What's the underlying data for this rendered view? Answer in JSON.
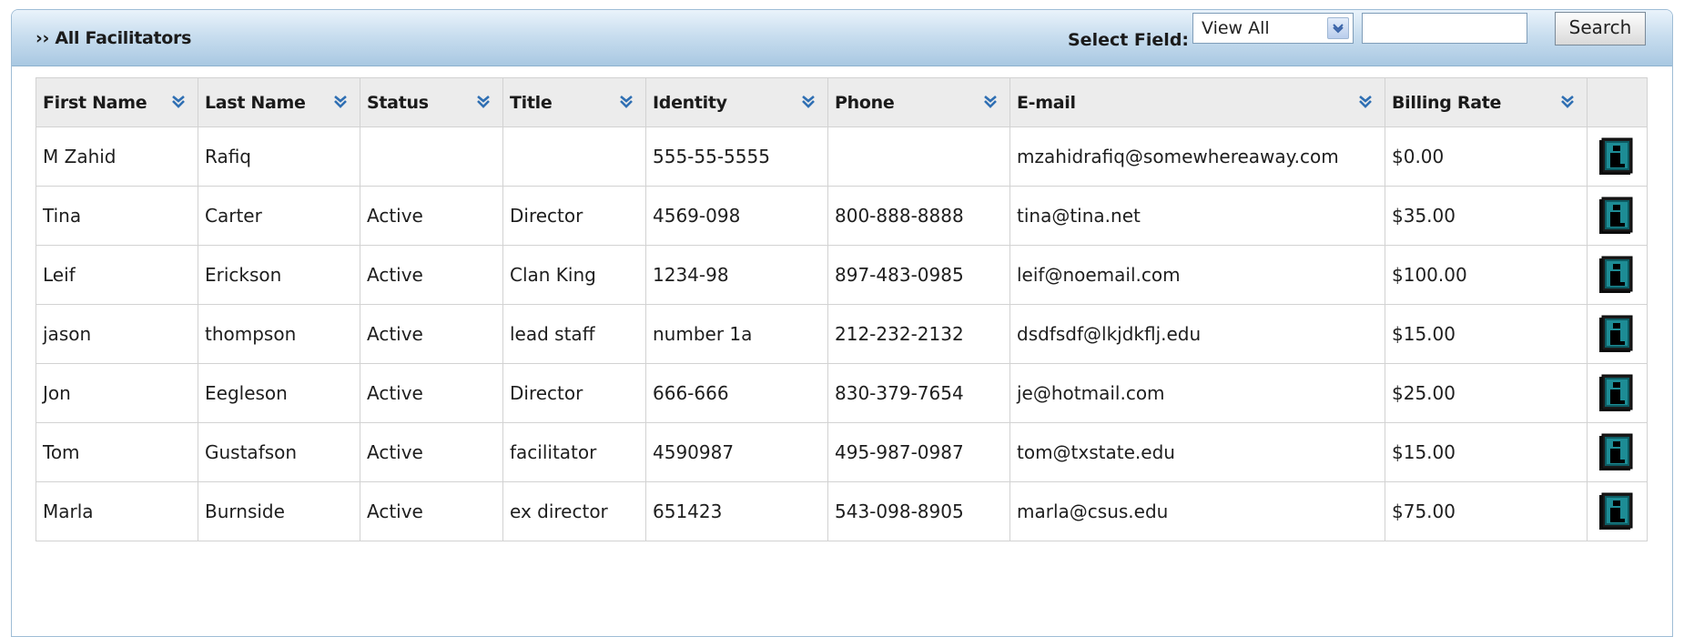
{
  "header": {
    "title": "›› All Facilitators",
    "select_label": "Select Field:",
    "select_value": "View All",
    "search_value": "",
    "search_button": "Search"
  },
  "columns": [
    "First Name",
    "Last Name",
    "Status",
    "Title",
    "Identity",
    "Phone",
    "E-mail",
    "Billing Rate"
  ],
  "rows": [
    {
      "first": "M Zahid",
      "last": "Rafiq",
      "status": "",
      "title": "",
      "identity": "555-55-5555",
      "phone": "",
      "email": "mzahidrafiq@somewhereaway.com",
      "rate": "$0.00"
    },
    {
      "first": "Tina",
      "last": "Carter",
      "status": "Active",
      "title": "Director",
      "identity": "4569-098",
      "phone": "800-888-8888",
      "email": "tina@tina.net",
      "rate": "$35.00"
    },
    {
      "first": "Leif",
      "last": "Erickson",
      "status": "Active",
      "title": "Clan King",
      "identity": "1234-98",
      "phone": "897-483-0985",
      "email": "leif@noemail.com",
      "rate": "$100.00"
    },
    {
      "first": "jason",
      "last": "thompson",
      "status": "Active",
      "title": "lead staff",
      "identity": "number 1a",
      "phone": "212-232-2132",
      "email": "dsdfsdf@lkjdkflj.edu",
      "rate": "$15.00"
    },
    {
      "first": "Jon",
      "last": "Eegleson",
      "status": "Active",
      "title": "Director",
      "identity": "666-666",
      "phone": "830-379-7654",
      "email": "je@hotmail.com",
      "rate": "$25.00"
    },
    {
      "first": "Tom",
      "last": "Gustafson",
      "status": "Active",
      "title": "facilitator",
      "identity": "4590987",
      "phone": "495-987-0987",
      "email": "tom@txstate.edu",
      "rate": "$15.00"
    },
    {
      "first": "Marla",
      "last": "Burnside",
      "status": "Active",
      "title": "ex director",
      "identity": "651423",
      "phone": "543-098-8905",
      "email": "marla@csus.edu",
      "rate": "$75.00"
    }
  ],
  "icons": {
    "sort": "sort-down-icon",
    "info": "info-icon"
  },
  "colors": {
    "header_gradient_top": "#eaf3fb",
    "header_gradient_bottom": "#a9c8e2",
    "sort_arrow": "#2f6fb3",
    "info_icon": "#0d5c63"
  }
}
